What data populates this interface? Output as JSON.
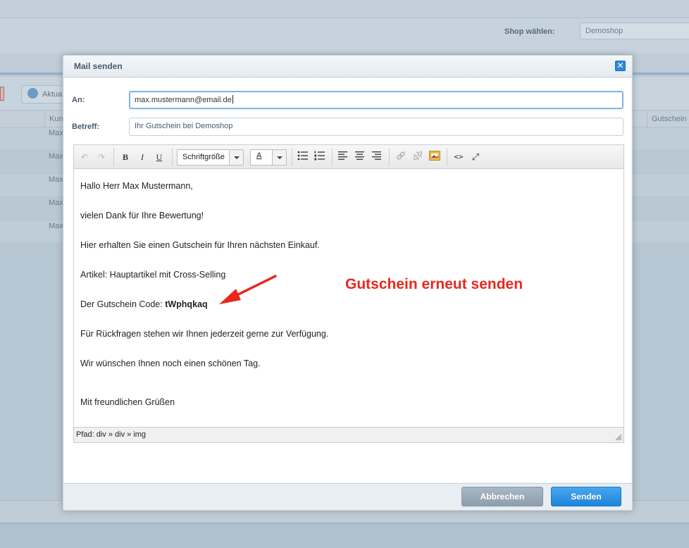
{
  "background": {
    "shop_label": "Shop wählen:",
    "shop_value": "Demoshop",
    "toolbar_button": "Aktua",
    "columns": {
      "kunde": "Kun",
      "gutschein": "Gutschein c"
    },
    "rows": [
      "Max",
      "Max",
      "Max",
      "Max",
      "Max"
    ]
  },
  "dialog": {
    "title": "Mail senden",
    "close_symbol": "✕",
    "to_label": "An:",
    "to_value": "max.mustermann@email.de",
    "subject_label": "Betreff:",
    "subject_value": "Ihr Gutschein bei Demoshop",
    "toolbar": {
      "undo": "↶",
      "redo": "↷",
      "bold": "B",
      "italic": "I",
      "underline": "U",
      "fontsize": "Schriftgröße",
      "fontcolor": "A",
      "code": "<>",
      "fullscreen": "⤢"
    },
    "body": {
      "greeting": "Hallo Herr Max Mustermann,",
      "thanks": "vielen Dank für Ihre Bewertung!",
      "voucher_intro": "Hier erhalten Sie einen Gutschein für Ihren nächsten Einkauf.",
      "article": "Artikel: Hauptartikel mit Cross-Selling",
      "code_label": "Der Gutschein Code: ",
      "code_value": "tWphqkaq",
      "questions": "Für Rückfragen stehen wir Ihnen jederzeit gerne zur Verfügung.",
      "wish": "Wir wünschen Ihnen noch einen schönen Tag.",
      "closing": "Mit freundlichen Grüßen"
    },
    "path": "Pfad: div » div » img",
    "cancel_label": "Abbrechen",
    "send_label": "Senden"
  },
  "annotation": {
    "text": "Gutschein erneut senden",
    "color": "#e8281e"
  }
}
